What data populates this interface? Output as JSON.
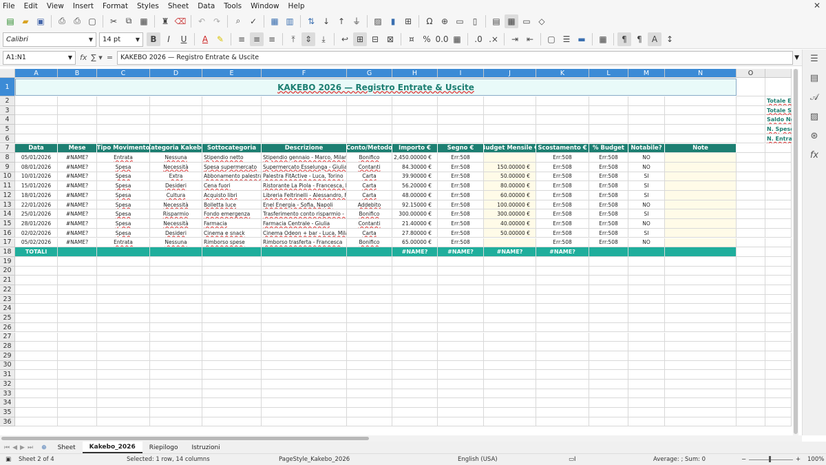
{
  "menu": [
    "File",
    "Edit",
    "View",
    "Insert",
    "Format",
    "Styles",
    "Sheet",
    "Data",
    "Tools",
    "Window",
    "Help"
  ],
  "toolbar2": {
    "font_name": "Calibri",
    "font_size": "14 pt"
  },
  "formula": {
    "cell_ref": "A1:N1",
    "content": "KAKEBO 2026 — Registro Entrate & Uscite"
  },
  "columns": [
    "A",
    "B",
    "C",
    "D",
    "E",
    "F",
    "G",
    "H",
    "I",
    "J",
    "K",
    "L",
    "M",
    "N",
    "O"
  ],
  "rows": [
    "1",
    "2",
    "3",
    "4",
    "5",
    "6",
    "7",
    "8",
    "9",
    "10",
    "11",
    "12",
    "13",
    "14",
    "15",
    "16",
    "17",
    "18",
    "19",
    "20",
    "21",
    "22",
    "23",
    "24",
    "25",
    "26",
    "27",
    "28",
    "29",
    "30",
    "31",
    "32",
    "33",
    "34",
    "35",
    "36"
  ],
  "title": "KAKEBO 2026 — Registro Entrate & Uscite",
  "summary_labels": [
    "Totale Entr",
    "Totale Spe",
    "Saldo Netto",
    "N. Spese",
    "N. Entrate"
  ],
  "headers": [
    "Data",
    "Mese",
    "Tipo Movimento",
    "Categoria Kakebo",
    "Sottocategoria",
    "Descrizione",
    "Conto/Metodo",
    "Importo €",
    "Segno €",
    "Budget Mensile €",
    "Scostamento €",
    "% Budget",
    "Notabile?",
    "Note"
  ],
  "records": [
    [
      "05/01/2026",
      "#NAME?",
      "Entrata",
      "Nessuna",
      "Stipendio netto",
      "Stipendio gennaio - Marco, Milano",
      "Bonifico",
      "2,450.00000 €",
      "Err:508",
      "",
      "Err:508",
      "Err:508",
      "NO",
      ""
    ],
    [
      "08/01/2026",
      "#NAME?",
      "Spesa",
      "Necessità",
      "Spesa supermercato",
      "Supermercato Esselunga - Giulia, M",
      "Contanti",
      "84.30000 €",
      "Err:508",
      "150.00000 €",
      "Err:508",
      "Err:508",
      "NO",
      ""
    ],
    [
      "10/01/2026",
      "#NAME?",
      "Spesa",
      "Extra",
      "Abbonamento palestra",
      "Palestra FitActive - Luca, Torino",
      "Carta",
      "39.90000 €",
      "Err:508",
      "50.00000 €",
      "Err:508",
      "Err:508",
      "SI",
      ""
    ],
    [
      "15/01/2026",
      "#NAME?",
      "Spesa",
      "Desideri",
      "Cena fuori",
      "Ristorante La Piola - Francesca, Bo",
      "Carta",
      "56.20000 €",
      "Err:508",
      "80.00000 €",
      "Err:508",
      "Err:508",
      "SI",
      ""
    ],
    [
      "18/01/2026",
      "#NAME?",
      "Spesa",
      "Cultura",
      "Acquisto libri",
      "Libreria Feltrinelli - Alessandro, Fi",
      "Carta",
      "48.00000 €",
      "Err:508",
      "60.00000 €",
      "Err:508",
      "Err:508",
      "SI",
      ""
    ],
    [
      "22/01/2026",
      "#NAME?",
      "Spesa",
      "Necessità",
      "Bolletta luce",
      "Enel Energia - Sofia, Napoli",
      "Addebito",
      "92.15000 €",
      "Err:508",
      "100.00000 €",
      "Err:508",
      "Err:508",
      "NO",
      ""
    ],
    [
      "25/01/2026",
      "#NAME?",
      "Spesa",
      "Risparmio",
      "Fondo emergenza",
      "Trasferimento conto risparmio - M",
      "Bonifico",
      "300.00000 €",
      "Err:508",
      "300.00000 €",
      "Err:508",
      "Err:508",
      "SI",
      ""
    ],
    [
      "28/01/2026",
      "#NAME?",
      "Spesa",
      "Necessità",
      "Farmacia",
      "Farmacia Centrale - Giulia",
      "Contanti",
      "21.40000 €",
      "Err:508",
      "40.00000 €",
      "Err:508",
      "Err:508",
      "NO",
      ""
    ],
    [
      "02/02/2026",
      "#NAME?",
      "Spesa",
      "Desideri",
      "Cinema e snack",
      "Cinema Odeon + bar - Luca, Milano",
      "Carta",
      "27.80000 €",
      "Err:508",
      "50.00000 €",
      "Err:508",
      "Err:508",
      "SI",
      ""
    ],
    [
      "05/02/2026",
      "#NAME?",
      "Entrata",
      "Nessuna",
      "Rimborso spese",
      "Rimborso trasferta - Francesca",
      "Bonifico",
      "65.00000 €",
      "Err:508",
      "",
      "Err:508",
      "Err:508",
      "NO",
      ""
    ]
  ],
  "totals": [
    "TOTALI",
    "",
    "",
    "",
    "",
    "",
    "",
    "#NAME?",
    "#NAME?",
    "#NAME?",
    "#NAME?",
    "",
    "",
    ""
  ],
  "sheet_tabs": [
    "Sheet",
    "Kakebo_2026",
    "Riepilogo",
    "Istruzioni"
  ],
  "status": {
    "sheet": "Sheet 2 of 4",
    "selection": "Selected: 1 row, 14 columns",
    "page_style": "PageStyle_Kakebo_2026",
    "language": "English (USA)",
    "sum": "Average: ; Sum: 0",
    "zoom": "100%"
  },
  "colors": {
    "header_teal": "#1d7f72",
    "total_teal": "#1fae9c",
    "title_text": "#1d7f72",
    "selection_blue": "#3c8bd6"
  }
}
